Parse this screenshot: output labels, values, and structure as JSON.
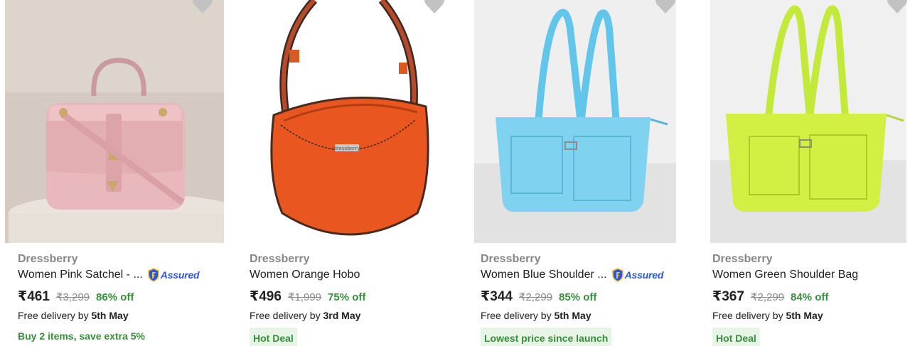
{
  "products": [
    {
      "brand": "Dressberry",
      "title": "Women Pink Satchel - ...",
      "assured": true,
      "assured_label": "Assured",
      "price": "₹461",
      "mrp": "₹3,299",
      "discount": "86% off",
      "delivery_prefix": "Free delivery by",
      "delivery_date": "5th May",
      "offer": "Buy 2 items, save extra 5%",
      "badge": null,
      "image_icon": "pink-satchel-bag-image"
    },
    {
      "brand": "Dressberry",
      "title": "Women Orange Hobo",
      "assured": false,
      "price": "₹496",
      "mrp": "₹1,999",
      "discount": "75% off",
      "delivery_prefix": "Free delivery by",
      "delivery_date": "3rd May",
      "offer": null,
      "badge": "Hot Deal",
      "bag_label": "dressberry",
      "image_icon": "orange-hobo-bag-image"
    },
    {
      "brand": "Dressberry",
      "title": "Women Blue Shoulder ...",
      "assured": true,
      "assured_label": "Assured",
      "price": "₹344",
      "mrp": "₹2,299",
      "discount": "85% off",
      "delivery_prefix": "Free delivery by",
      "delivery_date": "5th May",
      "offer": null,
      "badge": "Lowest price since launch",
      "image_icon": "blue-shoulder-bag-image"
    },
    {
      "brand": "Dressberry",
      "title": "Women Green Shoulder Bag",
      "assured": false,
      "price": "₹367",
      "mrp": "₹2,299",
      "discount": "84% off",
      "delivery_prefix": "Free delivery by",
      "delivery_date": "5th May",
      "offer": null,
      "badge": "Hot Deal",
      "image_icon": "green-shoulder-bag-image"
    }
  ],
  "colors": {
    "price_green": "#388e3c",
    "badge_bg": "#e6f5e6",
    "muted_gray": "#878787",
    "assured_blue": "#2a55e5"
  },
  "icons": [
    "heart-wishlist-icon",
    "assured-shield-icon"
  ]
}
